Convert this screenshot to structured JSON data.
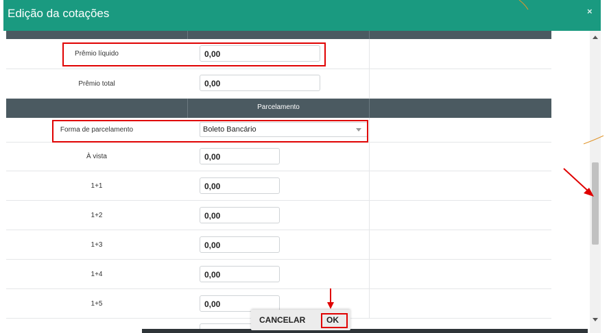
{
  "dialog": {
    "title": "Edição da cotações",
    "close_label": "×"
  },
  "rows": {
    "premio_liquido": {
      "label": "Prêmio líquido",
      "value": "0,00"
    },
    "premio_total": {
      "label": "Prêmio total",
      "value": "0,00"
    }
  },
  "section": {
    "title": "Parcelamento"
  },
  "forma": {
    "label": "Forma de parcelamento",
    "selected": "Boleto Bancário"
  },
  "installments": [
    {
      "label": "À vista",
      "value": "0,00"
    },
    {
      "label": "1+1",
      "value": "0,00"
    },
    {
      "label": "1+2",
      "value": "0,00"
    },
    {
      "label": "1+3",
      "value": "0,00"
    },
    {
      "label": "1+4",
      "value": "0,00"
    },
    {
      "label": "1+5",
      "value": "0,00"
    }
  ],
  "footer": {
    "cancel_label": "CANCELAR",
    "ok_label": "OK"
  },
  "colors": {
    "header": "#1a9a80",
    "section_bar": "#4b5a61",
    "highlight": "#e00000"
  }
}
